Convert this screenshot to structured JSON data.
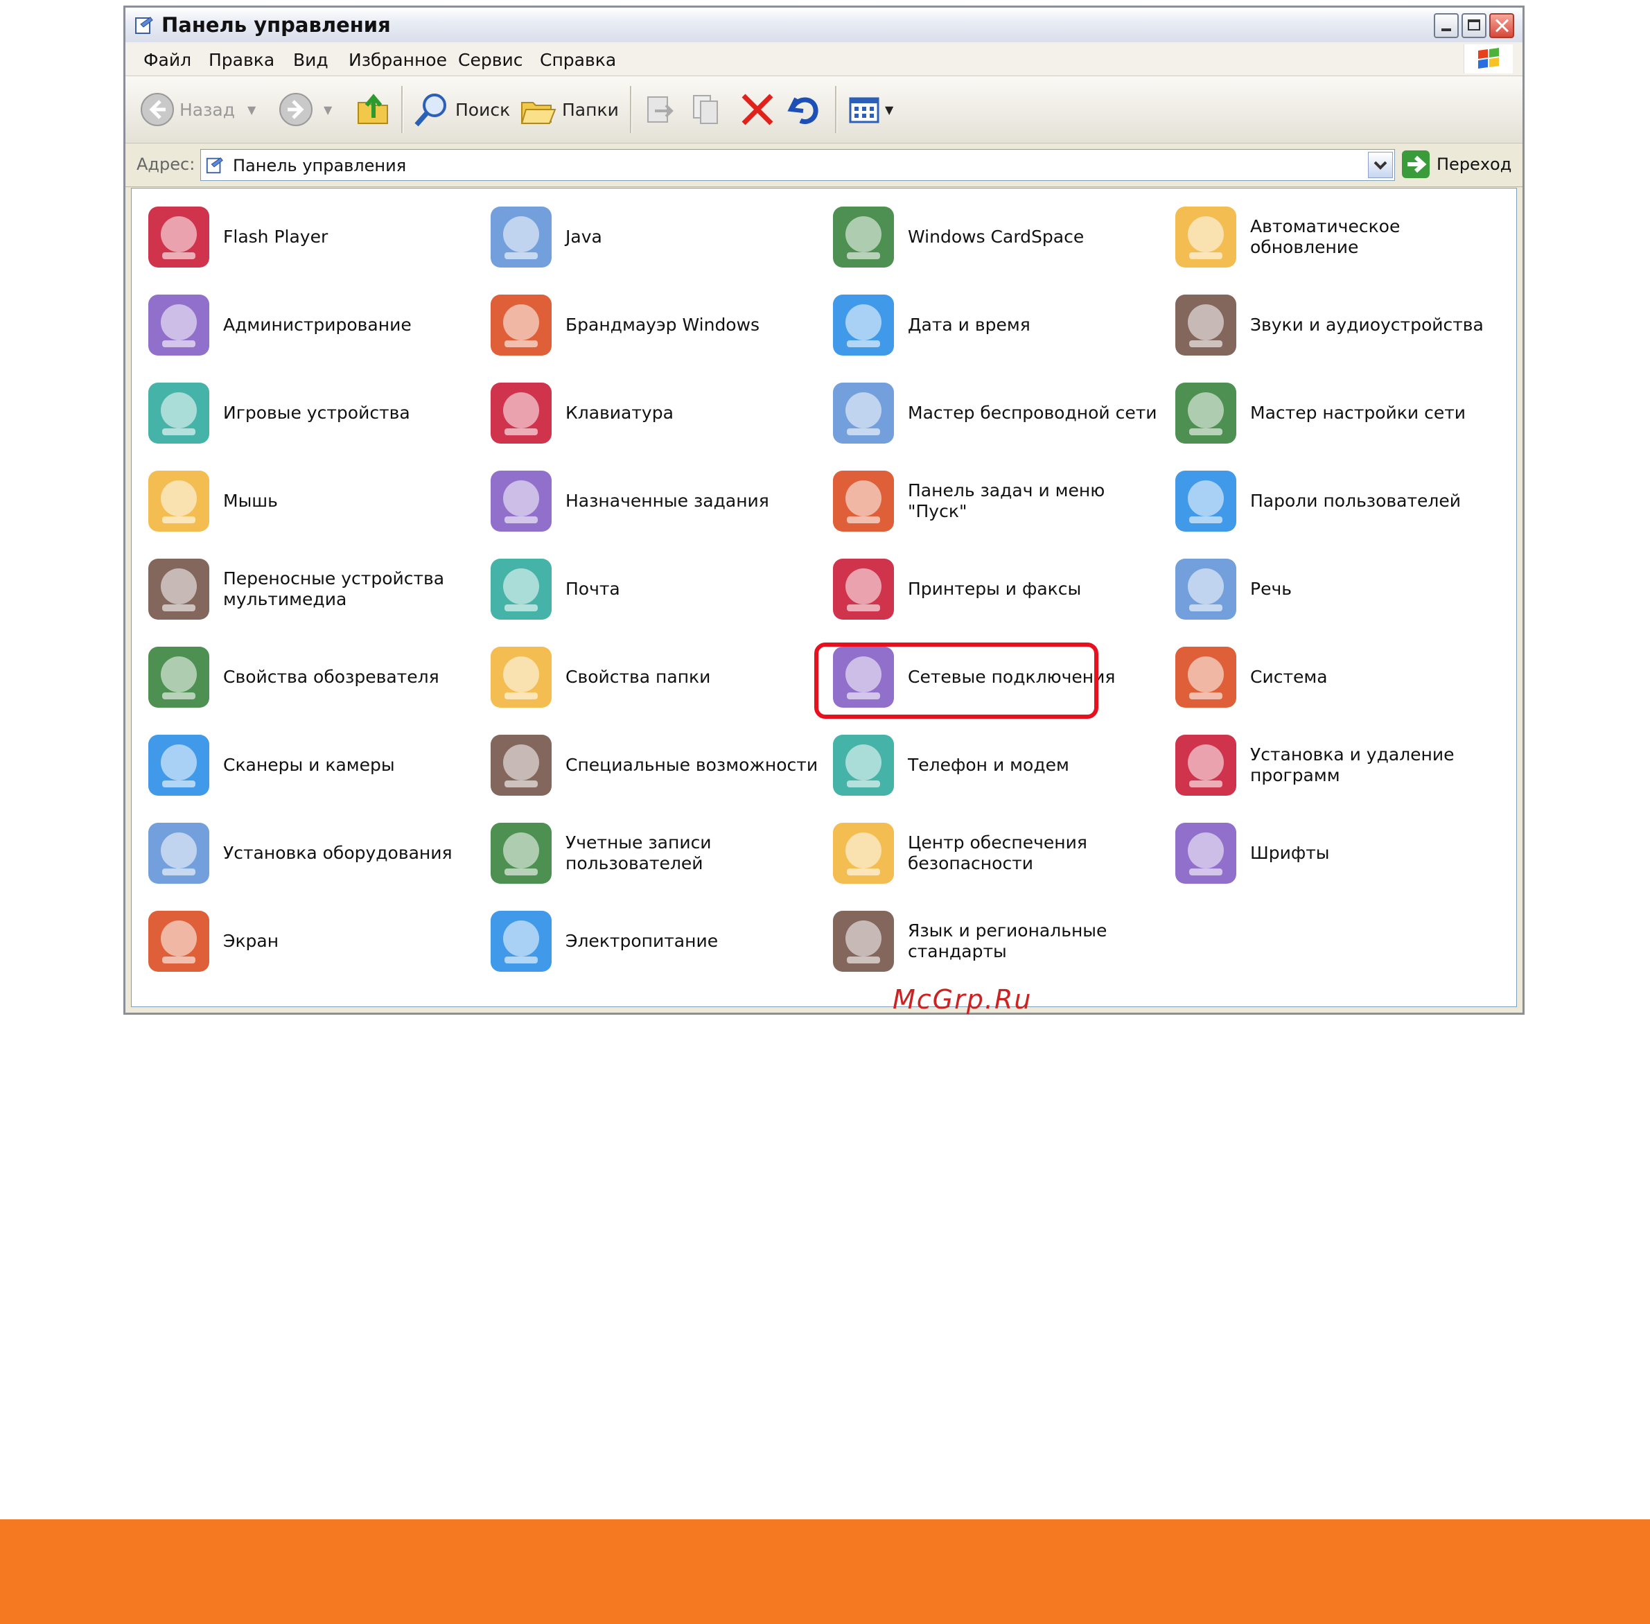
{
  "window": {
    "title": "Панель управления"
  },
  "menu": [
    "Файл",
    "Правка",
    "Вид",
    "Избранное",
    "Сервис",
    "Справка"
  ],
  "toolbar": {
    "back": "Назад",
    "search": "Поиск",
    "folders": "Папки"
  },
  "address": {
    "label": "Адрес:",
    "value": "Панель управления",
    "go": "Переход"
  },
  "items": [
    {
      "label": "Flash Player",
      "icon": "flash-icon"
    },
    {
      "label": "Java",
      "icon": "java-icon"
    },
    {
      "label": "Windows CardSpace",
      "icon": "cardspace-icon"
    },
    {
      "label": "Автоматическое обновление",
      "icon": "windows-update-icon"
    },
    {
      "label": "Администрирование",
      "icon": "admin-tools-icon"
    },
    {
      "label": "Брандмауэр Windows",
      "icon": "firewall-icon"
    },
    {
      "label": "Дата и время",
      "icon": "clock-icon"
    },
    {
      "label": "Звуки и аудиоустройства",
      "icon": "speaker-icon"
    },
    {
      "label": "Игровые устройства",
      "icon": "gamepad-icon"
    },
    {
      "label": "Клавиатура",
      "icon": "keyboard-icon"
    },
    {
      "label": "Мастер беспроводной сети",
      "icon": "wireless-icon"
    },
    {
      "label": "Мастер настройки сети",
      "icon": "home-network-icon"
    },
    {
      "label": "Мышь",
      "icon": "mouse-icon"
    },
    {
      "label": "Назначенные задания",
      "icon": "scheduled-tasks-icon"
    },
    {
      "label": "Панель задач и меню \"Пуск\"",
      "icon": "taskbar-icon"
    },
    {
      "label": "Пароли пользователей",
      "icon": "passwords-icon"
    },
    {
      "label": "Переносные устройства мультимедиа",
      "icon": "portable-device-icon"
    },
    {
      "label": "Почта",
      "icon": "mail-icon"
    },
    {
      "label": "Принтеры и факсы",
      "icon": "printer-icon"
    },
    {
      "label": "Речь",
      "icon": "speech-icon"
    },
    {
      "label": "Свойства обозревателя",
      "icon": "internet-options-icon"
    },
    {
      "label": "Свойства папки",
      "icon": "folder-options-icon"
    },
    {
      "label": "Сетевые подключения",
      "icon": "network-connections-icon"
    },
    {
      "label": "Система",
      "icon": "system-icon"
    },
    {
      "label": "Сканеры и камеры",
      "icon": "scanner-icon"
    },
    {
      "label": "Специальные возможности",
      "icon": "accessibility-icon"
    },
    {
      "label": "Телефон и модем",
      "icon": "phone-modem-icon"
    },
    {
      "label": "Установка и удаление программ",
      "icon": "add-remove-programs-icon"
    },
    {
      "label": "Установка оборудования",
      "icon": "add-hardware-icon"
    },
    {
      "label": "Учетные записи пользователей",
      "icon": "user-accounts-icon"
    },
    {
      "label": "Центр обеспечения безопасности",
      "icon": "security-center-icon"
    },
    {
      "label": "Шрифты",
      "icon": "fonts-icon"
    },
    {
      "label": "Экран",
      "icon": "display-icon"
    },
    {
      "label": "Электропитание",
      "icon": "power-icon"
    },
    {
      "label": "Язык и региональные стандарты",
      "icon": "regional-icon"
    }
  ],
  "highlighted_item": "Сетевые подключения",
  "watermark": "McGrp.Ru",
  "colors": {
    "highlight": "#e8101f",
    "footer": "#f47920"
  }
}
